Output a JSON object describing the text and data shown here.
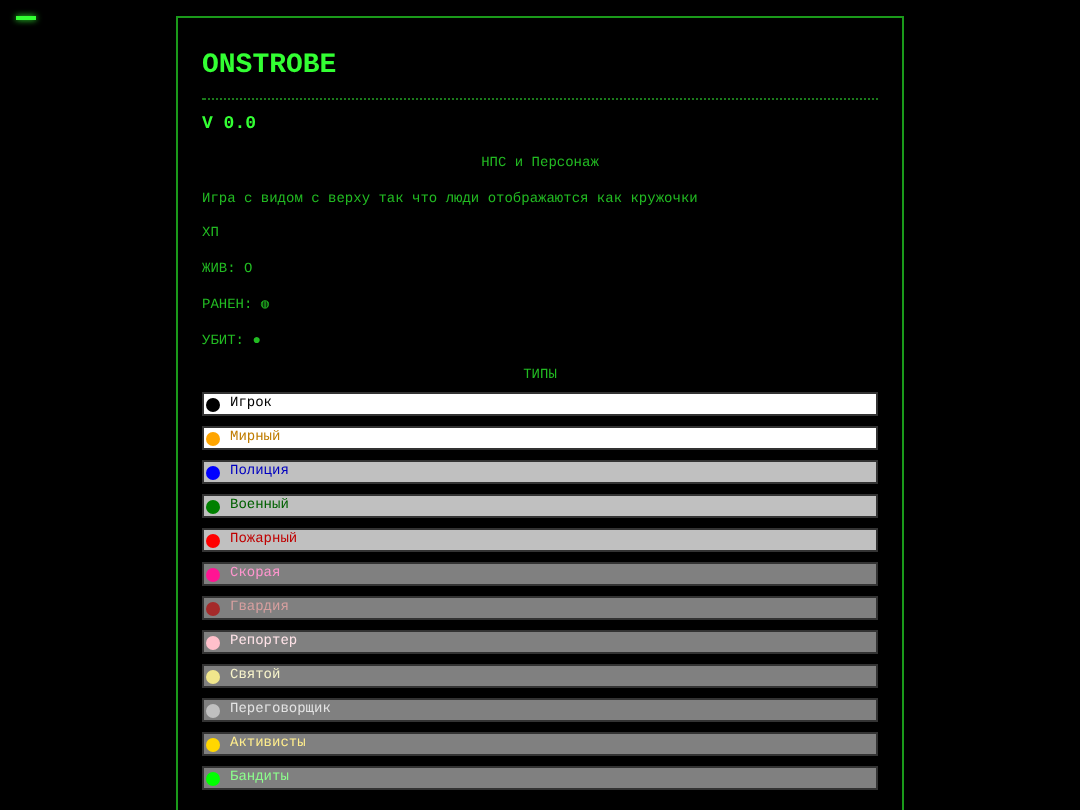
{
  "title": "ONSTROBE",
  "version": "V 0.0",
  "section_title": "НПС и Персонаж",
  "description": "Игра с видом с верху так что люди отображаются как кружочки",
  "stats": [
    "ХП",
    "ЖИВ: O",
    "РАНЕН: ◍",
    "УБИТ: ●"
  ],
  "types_title": "ТИПЫ",
  "types": [
    {
      "name": "Игрок",
      "color": "#000000",
      "kind": "white"
    },
    {
      "name": "Мирный",
      "color": "#ffa500",
      "kind": "white"
    },
    {
      "name": "Полиция",
      "color": "#0000ff",
      "kind": "light"
    },
    {
      "name": "Военный",
      "color": "#008000",
      "kind": "light"
    },
    {
      "name": "Пожарный",
      "color": "#ff0000",
      "kind": "light"
    },
    {
      "name": "Скорая",
      "color": "#ff1493",
      "kind": "dark"
    },
    {
      "name": "Гвардия",
      "color": "#a52a2a",
      "kind": "dark"
    },
    {
      "name": "Репортер",
      "color": "#ffc0cb",
      "kind": "dark"
    },
    {
      "name": "Святой",
      "color": "#f0e68c",
      "kind": "dark"
    },
    {
      "name": "Переговорщик",
      "color": "#c0c0c0",
      "kind": "dark"
    },
    {
      "name": "Активисты",
      "color": "#ffd700",
      "kind": "dark"
    },
    {
      "name": "Бандиты",
      "color": "#00ff00",
      "kind": "dark"
    }
  ]
}
